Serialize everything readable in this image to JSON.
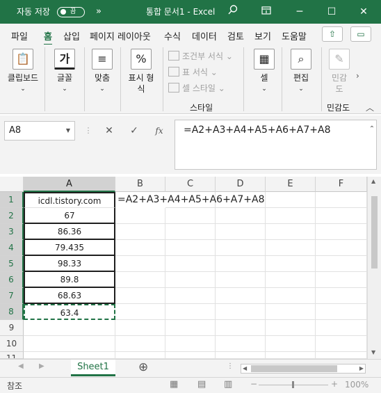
{
  "titlebar": {
    "autosave_label": "자동 저장",
    "autosave_state": "끔",
    "more": "»",
    "title": "통합 문서1  -  Excel",
    "search_icon": "magnifier-icon",
    "ribbon_display_icon": "ribbon-display-icon",
    "minimize": "─",
    "maximize": "☐",
    "close": "✕",
    "accent": "#217346"
  },
  "tabs": [
    "파일",
    "홈",
    "삽입",
    "페이지 레이아웃",
    "수식",
    "데이터",
    "검토",
    "보기",
    "도움말"
  ],
  "active_tab": "홈",
  "ribbon": {
    "clipboard": "클립보드",
    "font": "글꼴",
    "font_icon": "가",
    "align": "맞춤",
    "number": "표시 형식",
    "number_icon": "%",
    "cond_format": "조건부 서식",
    "table_format": "표 서식",
    "cell_styles": "셀 스타일",
    "styles_group": "스타일",
    "cells": "셀",
    "editing": "편집",
    "sensitivity": "민감도",
    "sensitivity_group": "민감도"
  },
  "formula_bar": {
    "name_box": "A8",
    "cancel": "✕",
    "enter": "✓",
    "fx": "fx",
    "formula": "=A2+A3+A4+A5+A6+A7+A8"
  },
  "grid": {
    "columns": [
      "A",
      "B",
      "C",
      "D",
      "E",
      "F"
    ],
    "rows": [
      "1",
      "2",
      "3",
      "4",
      "5",
      "6",
      "7",
      "8",
      "9",
      "10",
      "11"
    ],
    "a_values": [
      "icdl.tistory.com",
      "67",
      "86.36",
      "79.435",
      "98.33",
      "89.8",
      "68.63",
      "63.4"
    ],
    "b1_edit": "=A2+A3+A4+A5+A6+A7+A8"
  },
  "sheets": {
    "active": "Sheet1",
    "add": "⊕"
  },
  "status": {
    "mode": "참조",
    "zoom": "100%"
  }
}
